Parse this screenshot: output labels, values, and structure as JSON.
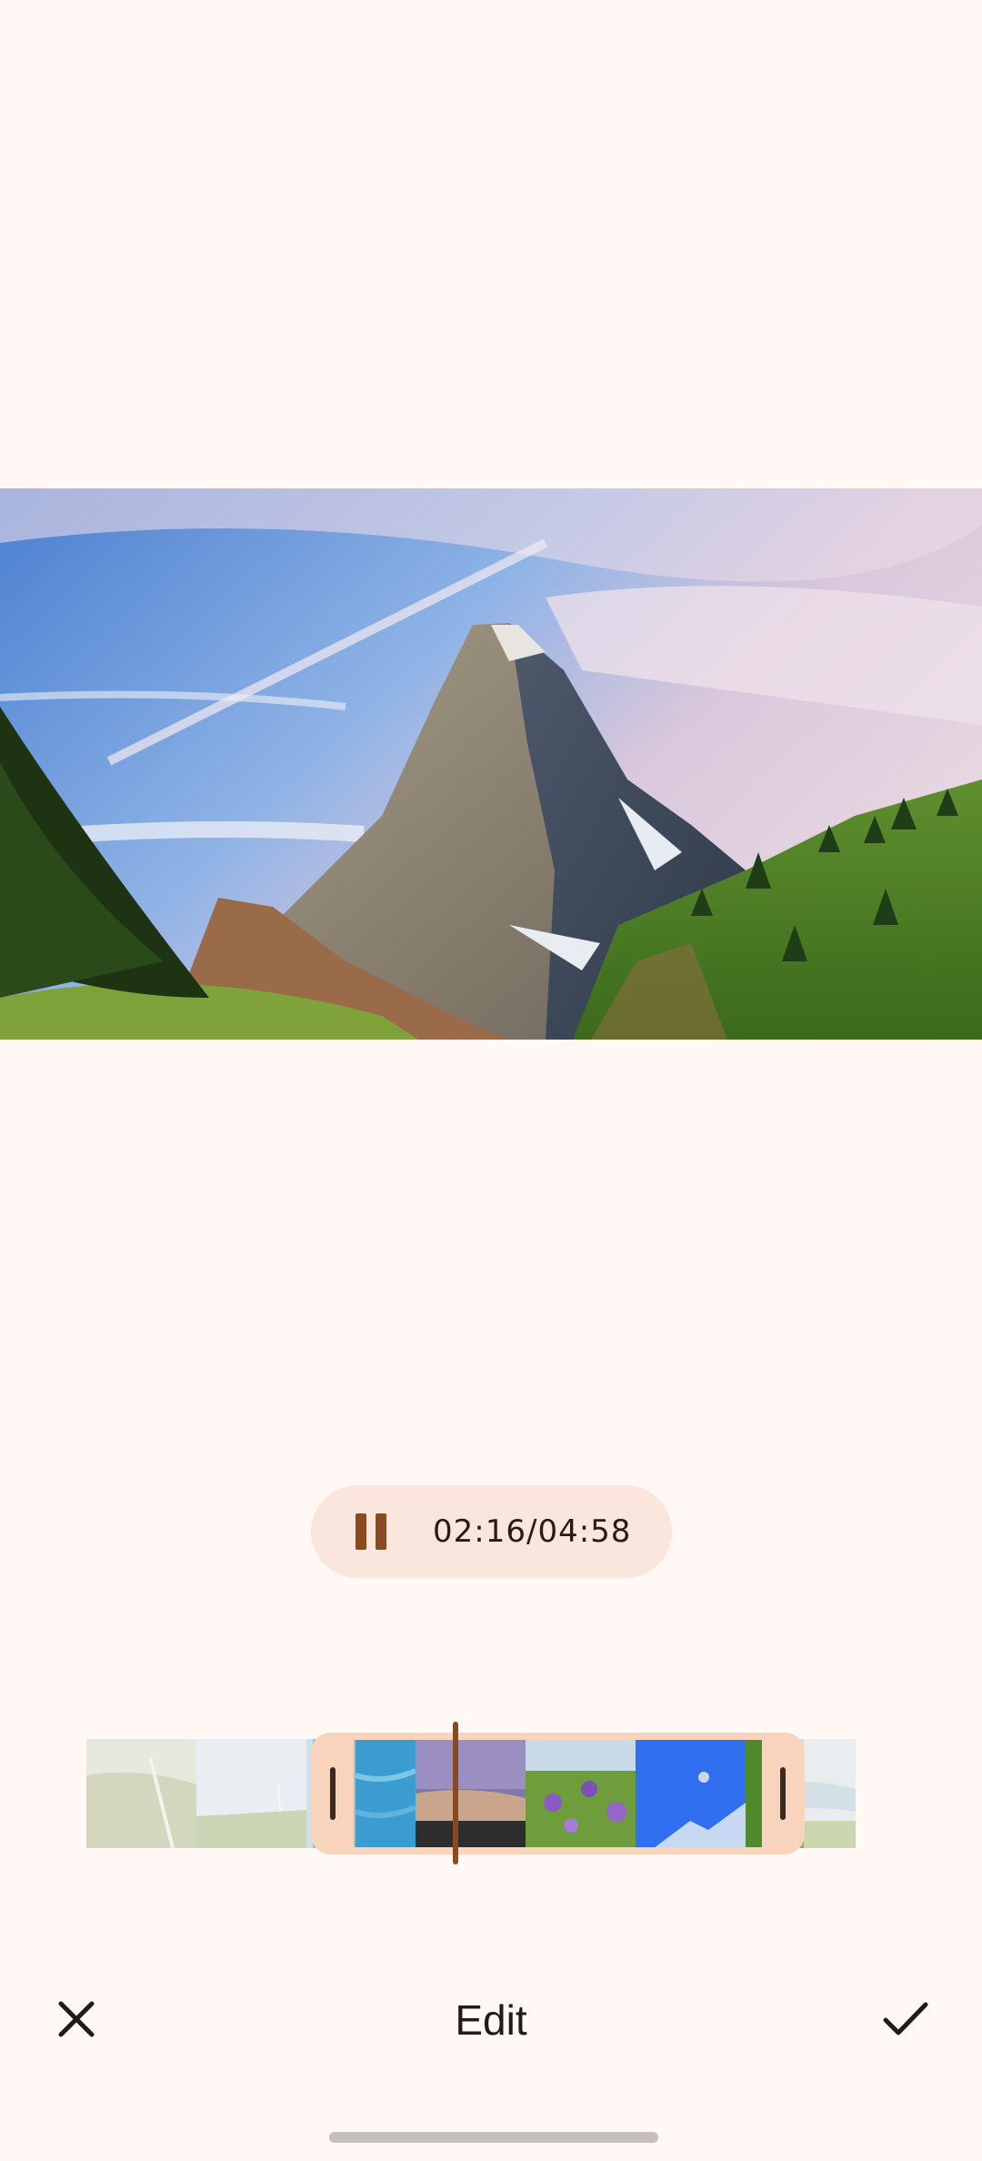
{
  "player": {
    "current_time": "02:16",
    "separator": "/",
    "total_time": "04:58"
  },
  "toolbar": {
    "title": "Edit"
  },
  "icons": {
    "pause": "pause-icon",
    "close": "close-icon",
    "confirm": "check-icon"
  },
  "colors": {
    "background": "#fff8f5",
    "accent": "#8a4a1f",
    "trim_frame": "#f9d4bd",
    "pill": "#fbe6dd"
  }
}
